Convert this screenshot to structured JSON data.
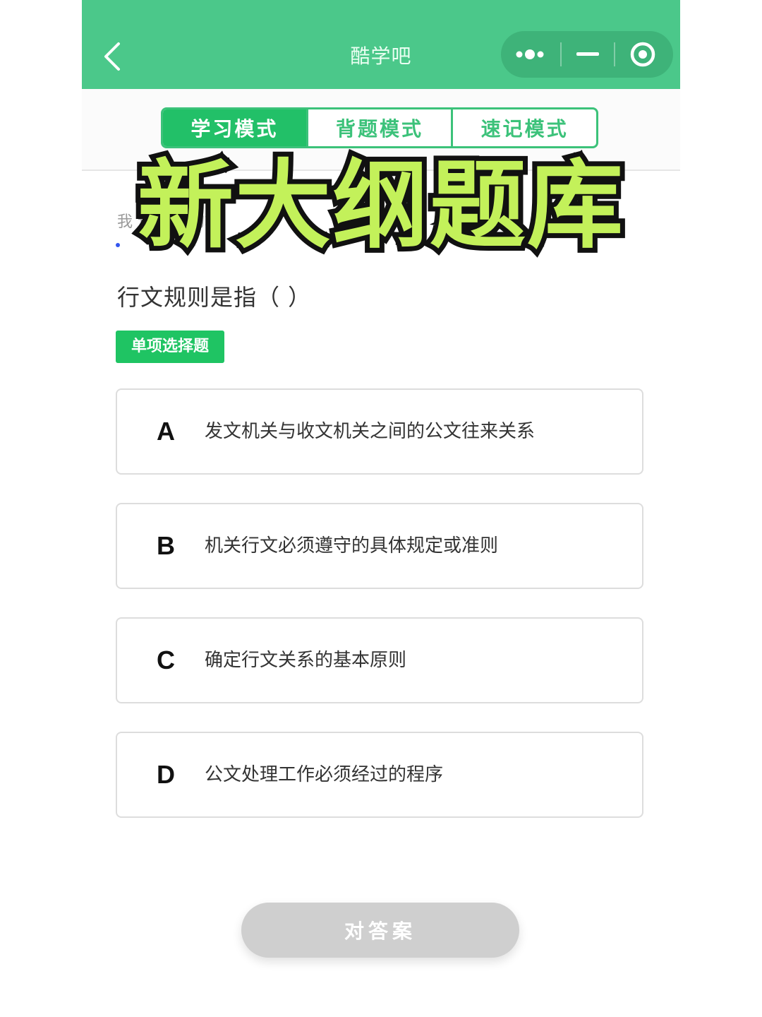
{
  "header": {
    "title": "酷学吧",
    "back_icon": "chevron-left-icon",
    "capsule_icons": [
      "more-dots-icon",
      "minimize-icon",
      "close-circle-icon"
    ]
  },
  "tabs": [
    {
      "label": "学习模式",
      "active": true
    },
    {
      "label": "背题模式",
      "active": false
    },
    {
      "label": "速记模式",
      "active": false
    }
  ],
  "hint_text": "我    诊断    后的算",
  "banner": "新大纲题库",
  "question": {
    "text": "行文规则是指（   ）",
    "type_label": "单项选择题"
  },
  "options": [
    {
      "letter": "A",
      "text": "发文机关与收文机关之间的公文往来关系"
    },
    {
      "letter": "B",
      "text": "机关行文必须遵守的具体规定或准则"
    },
    {
      "letter": "C",
      "text": "确定行文关系的基本原则"
    },
    {
      "letter": "D",
      "text": "公文处理工作必须经过的程序"
    }
  ],
  "submit_label": "对答案",
  "colors": {
    "appbar": "#4bc88a",
    "accent": "#22c068",
    "banner_fill": "#c3f15a",
    "submit_disabled": "#cfcfcf"
  }
}
